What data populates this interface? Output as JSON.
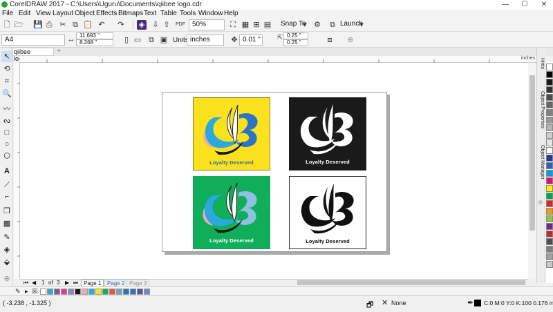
{
  "window": {
    "title": "CorelDRAW 2017 - C:\\Users\\Uguru\\Documents\\qiibee logo.cdr",
    "minimize": "—",
    "maximize": "☐",
    "close": "✕"
  },
  "menu": [
    "File",
    "Edit",
    "View",
    "Layout",
    "Object",
    "Effects",
    "Bitmaps",
    "Text",
    "Table",
    "Tools",
    "Window",
    "Help"
  ],
  "toolbar": {
    "zoom": "50%",
    "snap_to": "Snap To",
    "launch": "Launch"
  },
  "property_bar": {
    "page_size": "A4",
    "width": "11.693 \"",
    "height": "8.268 \"",
    "units_label": "Units:",
    "units": "inches",
    "nudge": "0.01 \"",
    "dup_x": "0.25 \"",
    "dup_y": "0.25 \""
  },
  "document_tab": "qiibee logo.cdr",
  "ruler": {
    "units": "inches"
  },
  "logos": [
    {
      "caption": "Loyalty Deserved",
      "bg": "#fbe11e",
      "text_color": "#2a6ca8",
      "style": "color"
    },
    {
      "caption": "Loyalty Deserved",
      "bg": "#1a1a1a",
      "text_color": "#ffffff",
      "style": "white"
    },
    {
      "caption": "Loyalty Deserved",
      "bg": "#10ae5b",
      "text_color": "#ffffff",
      "style": "color"
    },
    {
      "caption": "Loyalty Deserved",
      "bg": "#ffffff",
      "text_color": "#111111",
      "style": "black"
    }
  ],
  "dockers": {
    "hints": "Hints",
    "object_properties": "Object Properties",
    "object_manager": "Object Manager"
  },
  "page_nav": {
    "position": "1",
    "of_label": "of",
    "total": "3",
    "pages": [
      "Page 1",
      "Page 2",
      "Page 3"
    ]
  },
  "palette_colors": [
    "#ffffff",
    "#000000",
    "#1a1a1a",
    "#333333",
    "#4d4d4d",
    "#666666",
    "#808080",
    "#999999",
    "#b3b3b3",
    "#cccccc",
    "#e6e6e6",
    "#ffffff",
    "#1f3a93",
    "#2b5fc2",
    "#00a0e3",
    "#e5097f",
    "#fff200",
    "#00a651",
    "#ed1c24",
    "#f7941d",
    "#8dc63f",
    "#662d91",
    "#c1272d",
    "#4d4d4d",
    "#7f7f7f",
    "#a0a0a0",
    "#c8c8c8"
  ],
  "document_palette": [
    "#ffffff",
    "#2aa9df",
    "#8b4f9e",
    "#e03a8f",
    "#8a8ac0",
    "#1a1a1a",
    "#f1a7b6",
    "#2aa9df",
    "#fbe11e",
    "#10ae5b",
    "#e8563a",
    "#6aa7c9",
    "#3c6db5",
    "#2b74c6",
    "#4e56a6",
    "#7b7fd0"
  ],
  "status": {
    "coords": "( -3.238 , -1.325 )",
    "fill": "None",
    "outline": "C:0 M:0 Y:0 K:100  0.176 mm"
  }
}
